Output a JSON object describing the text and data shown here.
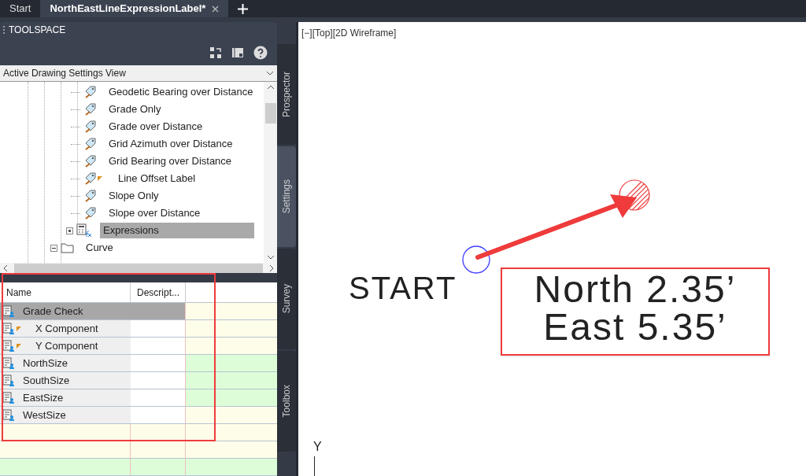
{
  "file_tabs": [
    {
      "label": "Start",
      "selected": false
    },
    {
      "label": "NorthEastLineExpressionLabel*",
      "selected": true
    }
  ],
  "toolspace": {
    "title": "TOOLSPACE",
    "view_select": "Active Drawing Settings View",
    "tree": [
      {
        "children": [
          {
            "label": "Geodetic Bearing over Distance",
            "kind": "style",
            "flag": false,
            "selected": false
          },
          {
            "label": "Grade Only",
            "kind": "style",
            "flag": false,
            "selected": false
          },
          {
            "label": "Grade over Distance",
            "kind": "style",
            "flag": false,
            "selected": false
          },
          {
            "label": "Grid Azimuth over Distance",
            "kind": "style",
            "flag": false,
            "selected": false
          },
          {
            "label": "Grid Bearing over Distance",
            "kind": "style",
            "flag": false,
            "selected": false
          },
          {
            "label": "Line Offset Label",
            "kind": "style",
            "flag": true,
            "selected": false
          },
          {
            "label": "Slope Only",
            "kind": "style",
            "flag": false,
            "selected": false
          },
          {
            "label": "Slope over Distance",
            "kind": "style",
            "flag": false,
            "selected": false
          },
          {
            "label": "Expressions",
            "kind": "expressions",
            "flag": false,
            "selected": true
          }
        ]
      },
      {
        "label": "Curve",
        "kind": "folder",
        "flag": false,
        "selected": false
      }
    ],
    "grid": {
      "columns": [
        "Name",
        "Descript..."
      ],
      "rows": [
        {
          "name": "Grade Check",
          "flag": false,
          "selected": true,
          "color": "#fdfde9"
        },
        {
          "name": "X Component",
          "flag": true,
          "selected": false,
          "color": "#fdfde9"
        },
        {
          "name": "Y Component",
          "flag": true,
          "selected": false,
          "color": "#fdfde9"
        },
        {
          "name": "NorthSize",
          "flag": false,
          "selected": false,
          "color": "#dcfdd8"
        },
        {
          "name": "SouthSize",
          "flag": false,
          "selected": false,
          "color": "#dcfdd8"
        },
        {
          "name": "EastSize",
          "flag": false,
          "selected": false,
          "color": "#dcfdd8"
        },
        {
          "name": "WestSize",
          "flag": false,
          "selected": false,
          "color": "#fdfde9"
        }
      ],
      "empty_rows": [
        {
          "color": "#fdfde9"
        },
        {
          "color": "#fdfde9"
        },
        {
          "color": "#dcfdd8"
        }
      ]
    },
    "side_tabs": [
      {
        "label": "Prospector",
        "selected": false
      },
      {
        "label": "Settings",
        "selected": true
      },
      {
        "label": "Survey",
        "selected": false
      },
      {
        "label": "Toolbox",
        "selected": false
      }
    ]
  },
  "viewport": {
    "controls": "[−][Top][2D Wireframe]",
    "start_label": "START",
    "label_lines": [
      "North 2.35’",
      "East 5.35’"
    ],
    "axis_label": "Y"
  }
}
